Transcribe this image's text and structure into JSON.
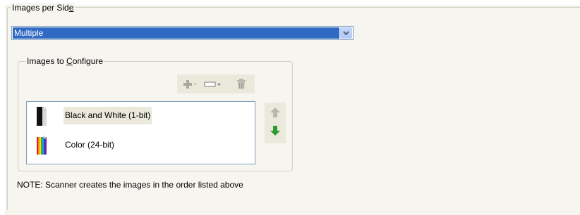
{
  "images_per_side": {
    "label_prefix": "Images per Sid",
    "label_mnemonic": "e",
    "selected_value": "Multiple"
  },
  "images_to_configure": {
    "label_prefix": "Images to ",
    "label_mnemonic": "C",
    "label_suffix": "onfigure",
    "toolbar": {
      "add_icon": "plus-icon",
      "change_icon": "rectangle-icon",
      "delete_icon": "trash-icon"
    },
    "items": [
      {
        "label": "Black and White (1-bit)",
        "icon": "bw-page-icon",
        "selected": true
      },
      {
        "label": "Color (24-bit)",
        "icon": "color-page-icon",
        "selected": false
      }
    ],
    "move_up_icon": "arrow-up-icon",
    "move_down_icon": "arrow-down-icon"
  },
  "note": "NOTE: Scanner creates the images in the order listed above",
  "colors": {
    "selection": "#316ac5",
    "panel": "#f7f5f0",
    "down_arrow": "#2f9a2f"
  }
}
